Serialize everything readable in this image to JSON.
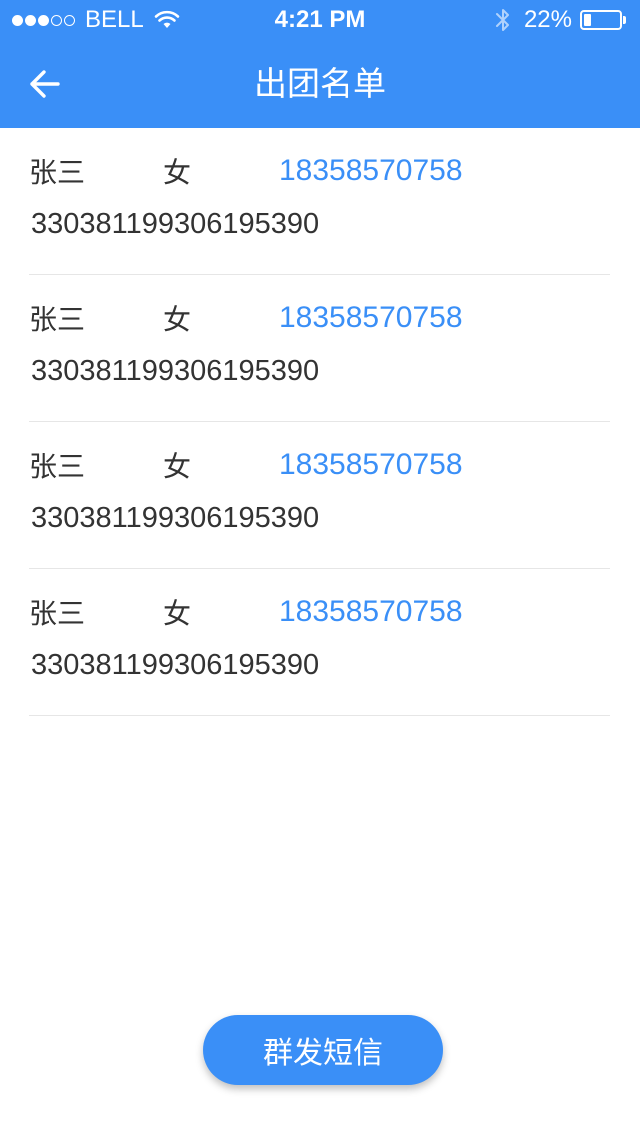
{
  "status_bar": {
    "carrier": "BELL",
    "time": "4:21 PM",
    "battery_percent": "22%",
    "battery_level": 0.22,
    "signal_bars_filled": 3,
    "signal_bars_total": 5
  },
  "header": {
    "title": "出团名单",
    "back_icon": "arrow-left-icon",
    "background": "#3a8ff7"
  },
  "members": [
    {
      "name": "张三",
      "gender": "女",
      "phone": "18358570758",
      "id_number": "330381199306195390"
    },
    {
      "name": "张三",
      "gender": "女",
      "phone": "18358570758",
      "id_number": "330381199306195390"
    },
    {
      "name": "张三",
      "gender": "女",
      "phone": "18358570758",
      "id_number": "330381199306195390"
    },
    {
      "name": "张三",
      "gender": "女",
      "phone": "18358570758",
      "id_number": "330381199306195390"
    }
  ],
  "actions": {
    "send_sms_label": "群发短信"
  },
  "colors": {
    "accent": "#3a8ff7",
    "text": "#333333",
    "divider": "#e6e6e6"
  }
}
